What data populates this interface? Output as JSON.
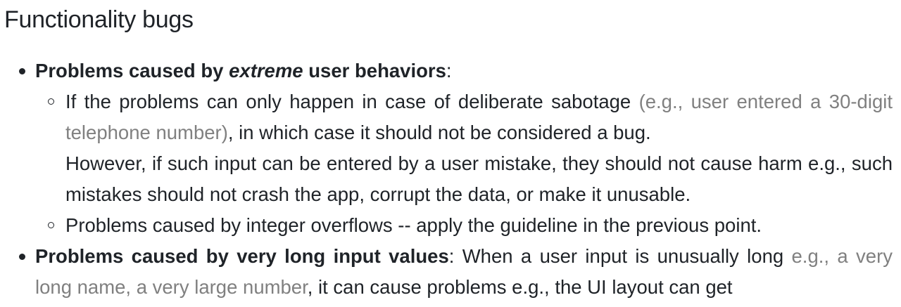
{
  "heading": "Functionality bugs",
  "items": [
    {
      "title_pre": "Problems caused by ",
      "title_em": "extreme",
      "title_post": " user behaviors",
      "colon": ":",
      "subitems": [
        {
          "text_a": "If the problems can only happen in case of deliberate sabotage ",
          "muted": "(e.g., user entered a 30-digit telephone number)",
          "text_b": ", in which case it should not be considered a bug.",
          "para2": "However, if such input can be entered by a user mistake, they should not cause harm e.g., such mistakes should not crash the app, corrupt the data, or make it unusable."
        },
        {
          "text": "Problems caused by integer overflows -- apply the guideline in the previous point."
        }
      ]
    },
    {
      "title": "Problems caused by very long input values",
      "text_a": ": When a user input is unusually long ",
      "muted": "e.g., a very long name, a very large number",
      "text_b": ", it can cause problems e.g., the UI layout can get"
    }
  ]
}
